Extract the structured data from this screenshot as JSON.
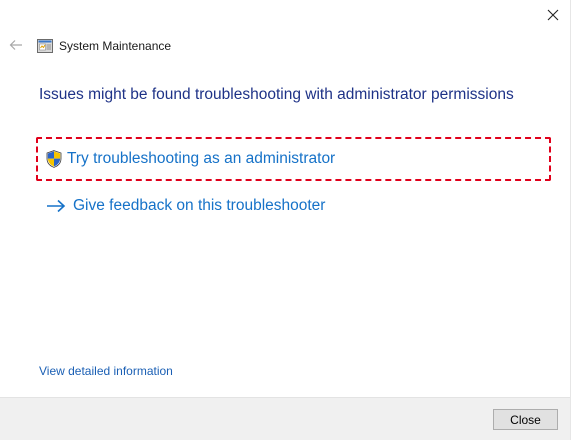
{
  "window": {
    "title": "System Maintenance"
  },
  "icons": {
    "close": "close-icon",
    "back": "back-arrow-icon",
    "app": "system-maintenance-icon",
    "shield": "uac-shield-icon",
    "arrow": "arrow-right-icon"
  },
  "main": {
    "heading": "Issues might be found troubleshooting with administrator permissions",
    "actions": [
      {
        "label": "Try troubleshooting as an administrator",
        "icon": "uac-shield-icon",
        "highlighted": true
      },
      {
        "label": "Give feedback on this troubleshooter",
        "icon": "arrow-right-icon",
        "highlighted": false
      }
    ],
    "details_link": "View detailed information"
  },
  "footer": {
    "close_label": "Close"
  },
  "colors": {
    "heading": "#1e3287",
    "link": "#1672c8",
    "highlight_border": "#e0001b",
    "footer_bg": "#f0f0f0"
  }
}
